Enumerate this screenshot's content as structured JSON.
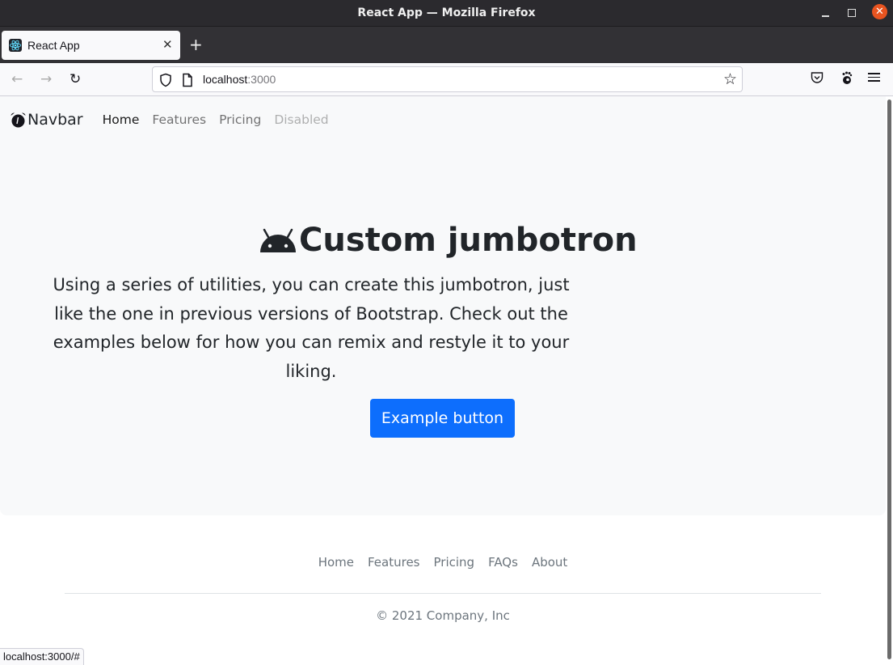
{
  "window": {
    "title": "React App — Mozilla Firefox",
    "close_glyph": "✕"
  },
  "tabs": [
    {
      "title": "React App",
      "icon": "react-logo-icon",
      "active": true,
      "close_glyph": "✕"
    }
  ],
  "new_tab_glyph": "+",
  "toolbar": {
    "back_glyph": "←",
    "forward_glyph": "→",
    "reload_glyph": "↻",
    "url_host": "localhost",
    "url_port": ":3000",
    "bookmark_glyph": "☆"
  },
  "site": {
    "brand": "Navbar",
    "brand_icon": "alarm-clock-icon",
    "nav": [
      {
        "label": "Home",
        "state": "active"
      },
      {
        "label": "Features",
        "state": "normal"
      },
      {
        "label": "Pricing",
        "state": "normal"
      },
      {
        "label": "Disabled",
        "state": "disabled"
      }
    ],
    "hero": {
      "icon": "android-icon",
      "title": "Custom jumbotron",
      "lead": "Using a series of utilities, you can create this jumbotron, just like the one in previous versions of Bootstrap. Check out the examples below for how you can remix and restyle it to your liking.",
      "button": "Example button"
    },
    "footer": {
      "links": [
        "Home",
        "Features",
        "Pricing",
        "FAQs",
        "About"
      ],
      "copyright": "© 2021 Company, Inc"
    }
  },
  "status_bar": {
    "text": "localhost:3000/#"
  },
  "colors": {
    "primary": "#0d6efd",
    "jumbotron_bg": "#f8f9fa",
    "muted": "#6c757d",
    "titlebar": "#2b2a2e",
    "close_button": "#e95420"
  }
}
